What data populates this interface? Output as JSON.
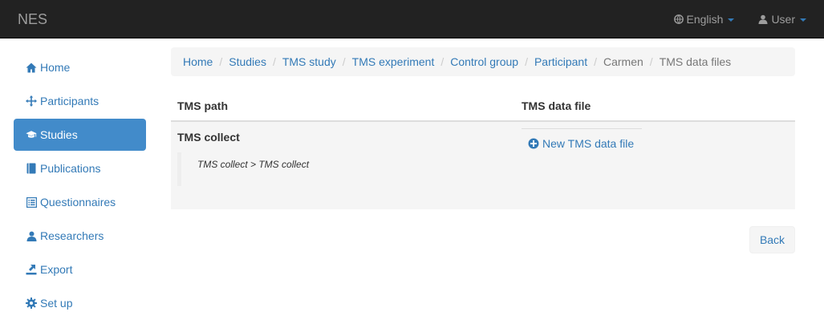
{
  "navbar": {
    "brand": "NES",
    "language": {
      "label": "English",
      "icon": "globe-icon"
    },
    "user": {
      "label": "User",
      "icon": "user-icon"
    }
  },
  "sidebar": {
    "items": [
      {
        "label": "Home",
        "icon": "home-icon",
        "active": false
      },
      {
        "label": "Participants",
        "icon": "move-icon",
        "active": false
      },
      {
        "label": "Studies",
        "icon": "education-icon",
        "active": true
      },
      {
        "label": "Publications",
        "icon": "book-icon",
        "active": false
      },
      {
        "label": "Questionnaires",
        "icon": "list-alt-icon",
        "active": false
      },
      {
        "label": "Researchers",
        "icon": "user-icon",
        "active": false
      },
      {
        "label": "Export",
        "icon": "export-icon",
        "active": false
      },
      {
        "label": "Set up",
        "icon": "cog-icon",
        "active": false
      }
    ]
  },
  "breadcrumb": [
    {
      "label": "Home",
      "link": true
    },
    {
      "label": "Studies",
      "link": true
    },
    {
      "label": "TMS study",
      "link": true
    },
    {
      "label": "TMS experiment",
      "link": true
    },
    {
      "label": "Control group",
      "link": true
    },
    {
      "label": "Participant",
      "link": true
    },
    {
      "label": "Carmen",
      "link": false
    },
    {
      "label": "TMS data files",
      "link": false
    }
  ],
  "table": {
    "headers": [
      "TMS path",
      "TMS data file"
    ],
    "rows": [
      {
        "step": "TMS collect",
        "path": "TMS collect > TMS collect",
        "action": "New TMS data file"
      }
    ]
  },
  "actions": {
    "back": "Back"
  },
  "colors": {
    "navbar": "#222222",
    "link": "#337ab7",
    "active": "#428bca",
    "panel": "#f5f5f5"
  }
}
